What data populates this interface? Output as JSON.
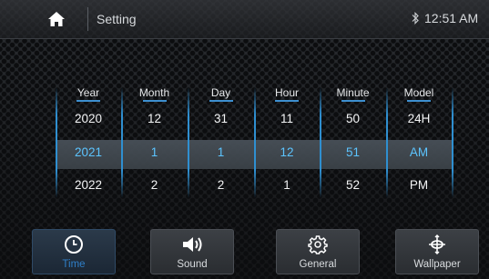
{
  "header": {
    "title": "Setting",
    "clock": "12:51 AM"
  },
  "picker": {
    "columns": [
      {
        "header": "Year",
        "values": [
          "2020",
          "2021",
          "2022"
        ]
      },
      {
        "header": "Month",
        "values": [
          "12",
          "1",
          "2"
        ]
      },
      {
        "header": "Day",
        "values": [
          "31",
          "1",
          "2"
        ]
      },
      {
        "header": "Hour",
        "values": [
          "11",
          "12",
          "1"
        ]
      },
      {
        "header": "Minute",
        "values": [
          "50",
          "51",
          "52"
        ]
      },
      {
        "header": "Model",
        "values": [
          "24H",
          "AM",
          "PM"
        ]
      }
    ]
  },
  "tabs": [
    {
      "label": "Time",
      "icon": "clock-icon",
      "active": true
    },
    {
      "label": "Sound",
      "icon": "speaker-icon",
      "active": false
    },
    {
      "label": "General",
      "icon": "gear-icon",
      "active": false
    },
    {
      "label": "Wallpaper",
      "icon": "wallpaper-icon",
      "active": false
    }
  ],
  "colors": {
    "accent": "#2f8fd0",
    "selected_text": "#5cc4ff",
    "selection_band": "#444b52"
  }
}
